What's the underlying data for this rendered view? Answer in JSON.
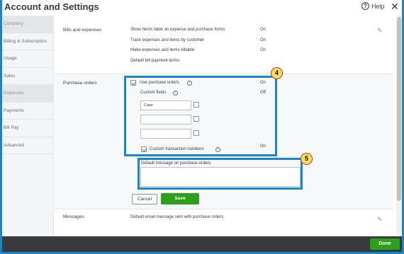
{
  "window": {
    "title": "Account and Settings",
    "help_label": "Help",
    "help_glyph": "?",
    "close_glyph": "✕"
  },
  "sidebar": {
    "items": [
      {
        "label": "Company"
      },
      {
        "label": "Billing & Subscription"
      },
      {
        "label": "Usage"
      },
      {
        "label": "Sales"
      },
      {
        "label": "Expenses"
      },
      {
        "label": "Payments"
      },
      {
        "label": "Bill Pay"
      },
      {
        "label": "Advanced"
      }
    ],
    "active": "Company"
  },
  "bills_section": {
    "label": "Bills and expenses",
    "rows": [
      {
        "text": "Show Items table on expense and purchase forms",
        "value": "On"
      },
      {
        "text": "Track expenses and items by customer",
        "value": "On"
      },
      {
        "text": "Make expenses and items billable",
        "value": "On"
      },
      {
        "text": "Default bill payment terms",
        "value": ""
      }
    ]
  },
  "purchase_orders": {
    "label": "Purchase orders",
    "use_po_label": "Use purchase orders",
    "use_po_value": "On",
    "use_po_checked": true,
    "custom_fields_label": "Custom fields",
    "custom_fields_value": "Off",
    "custom_field_values": [
      "Case",
      "",
      ""
    ],
    "custom_txn_label": "Custom transaction numbers",
    "custom_txn_value": "On",
    "custom_txn_checked": true,
    "default_message_label": "Default message on purchase orders",
    "cancel_label": "Cancel",
    "save_label": "Save",
    "badges": [
      "4",
      "5"
    ]
  },
  "messages_section": {
    "label": "Messages",
    "text": "Default email message sent with purchase orders"
  },
  "footer": {
    "done_label": "Done"
  },
  "colors": {
    "accent_blue": "#1a86c8",
    "save_green": "#2ca01c",
    "badge_yellow": "#fde35a",
    "badge_red": "#d02f1b",
    "footer_dark": "#393a3d"
  },
  "icons": {
    "pencil": "✎",
    "info": "i"
  }
}
